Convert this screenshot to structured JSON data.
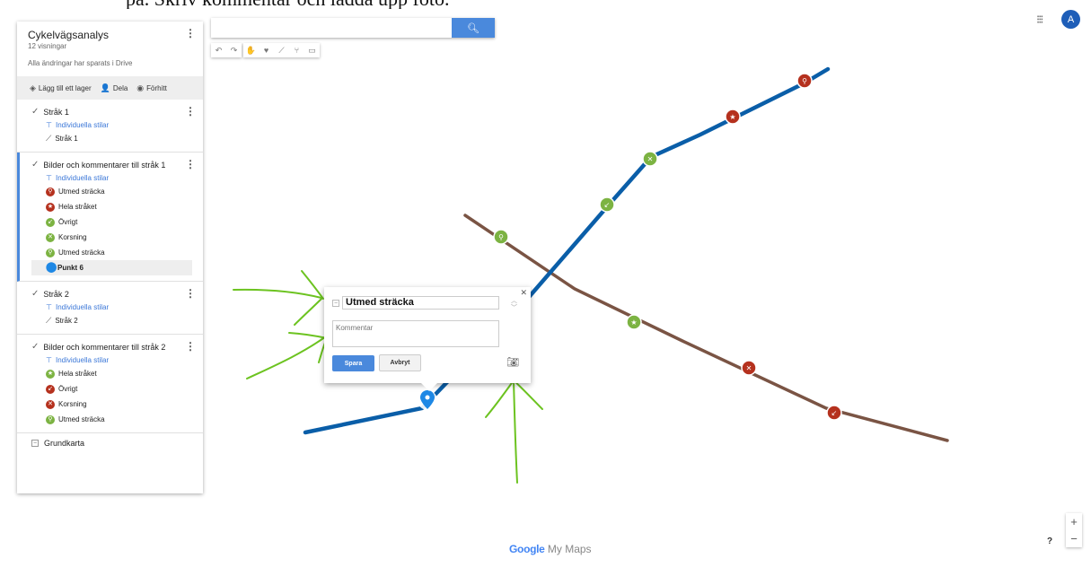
{
  "caption_text": "på. Skriv kommentar och ladda upp foto.",
  "panel": {
    "title": "Cykelvägsanalys",
    "views": "12 visningar",
    "saved": "Alla ändringar har sparats i Drive",
    "toolbar": {
      "add_layer": "Lägg till ett lager",
      "share": "Dela",
      "preview": "Förhitt"
    },
    "layers": [
      {
        "title": "Stråk 1",
        "styles": "Individuella stilar",
        "items": [
          {
            "label": "Stråk 1",
            "icon": "line-icon"
          }
        ]
      },
      {
        "title": "Bilder och kommentarer till stråk 1",
        "styles": "Individuella stilar",
        "items": [
          {
            "label": "Utmed sträcka",
            "icon": "bike-icon",
            "color": "#b5311e"
          },
          {
            "label": "Hela stråket",
            "icon": "star-icon",
            "color": "#b5311e"
          },
          {
            "label": "Övrigt",
            "icon": "arrow-icon",
            "color": "#7cb342"
          },
          {
            "label": "Korsning",
            "icon": "cross-icon",
            "color": "#7cb342"
          },
          {
            "label": "Utmed sträcka",
            "icon": "bike-icon",
            "color": "#7cb342"
          },
          {
            "label": "Punkt 6",
            "icon": "pin-icon",
            "color": "#1e88e5"
          }
        ]
      },
      {
        "title": "Stråk 2",
        "styles": "Individuella stilar",
        "items": [
          {
            "label": "Stråk 2",
            "icon": "line-icon"
          }
        ]
      },
      {
        "title": "Bilder och kommentarer till stråk 2",
        "styles": "Individuella stilar",
        "items": [
          {
            "label": "Hela stråket",
            "icon": "star-icon",
            "color": "#7cb342"
          },
          {
            "label": "Övrigt",
            "icon": "arrow-icon",
            "color": "#b5311e"
          },
          {
            "label": "Korsning",
            "icon": "cross-icon",
            "color": "#b5311e"
          },
          {
            "label": "Utmed sträcka",
            "icon": "bike-icon",
            "color": "#7cb342"
          }
        ]
      }
    ],
    "basemap": "Grundkarta"
  },
  "search": {
    "placeholder": ""
  },
  "account": {
    "initial": "A"
  },
  "popup": {
    "title": "Utmed sträcka",
    "comment_placeholder": "Kommentar",
    "save": "Spara",
    "cancel": "Avbryt"
  },
  "logo": {
    "brand": "Google",
    "product": " My Maps"
  },
  "colors": {
    "route1": "#0a5ea8",
    "route2": "#7a5444",
    "marker_red": "#b5311e",
    "marker_green": "#7cb342",
    "annotation": "#6cc320",
    "accent": "#4a89dc"
  }
}
